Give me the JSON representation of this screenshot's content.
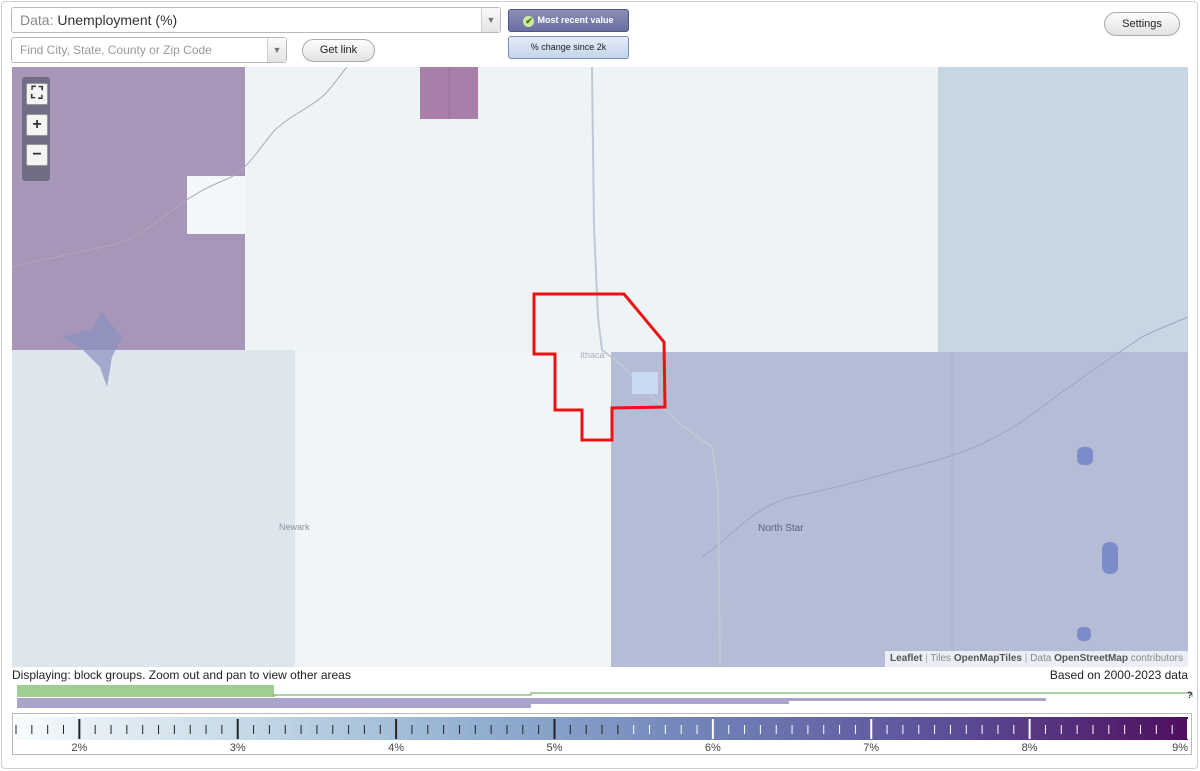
{
  "controls": {
    "data_label": "Data:",
    "data_value": "Unemployment (%)",
    "search_placeholder": "Find City, State, County or Zip Code",
    "get_link": "Get link",
    "settings": "Settings",
    "mode_active": "Most recent value",
    "mode_alt": "% change since 2k"
  },
  "map": {
    "places": [
      {
        "name": "Ithaca"
      },
      {
        "name": "Newark"
      },
      {
        "name": "North Star"
      }
    ],
    "attribution": {
      "leaflet": "Leaflet",
      "tiles_label": "Tiles",
      "tiles": "OpenMapTiles",
      "data_label": "Data",
      "data": "OpenStreetMap",
      "contributors": "contributors"
    },
    "colors": {
      "selected_outline": "#ee1111",
      "high_purple": "#a896b8",
      "medium_blue": "#b4bcd6",
      "light_blue": "#c6d7e3",
      "pale": "#eef3f6"
    }
  },
  "footer": {
    "displaying": "Displaying: block groups. Zoom out and pan to view other areas",
    "based_on": "Based on 2000-2023 data",
    "help": "?"
  },
  "legend": {
    "min": 1.6,
    "max": 9.0,
    "labels": [
      "2%",
      "3%",
      "4%",
      "5%",
      "6%",
      "7%",
      "8%",
      "9%"
    ],
    "colors": [
      "#f7fbfd",
      "#c4d8e6",
      "#90aed0",
      "#6f7fb6",
      "#5b4d96",
      "#4f0e5e"
    ]
  }
}
